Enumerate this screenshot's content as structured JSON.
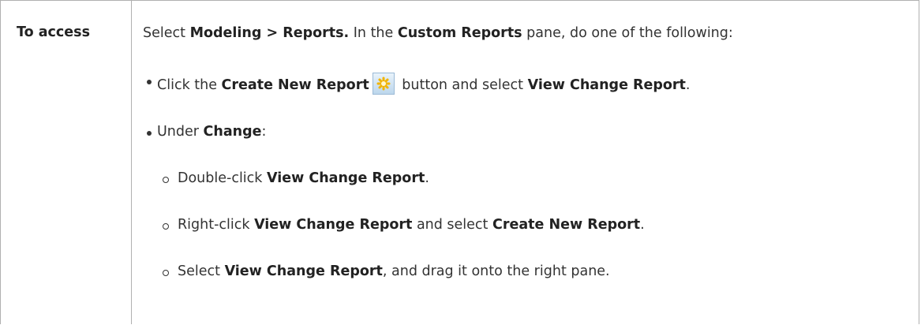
{
  "table": {
    "header_cell": "To access",
    "intro": {
      "t1": "Select ",
      "b1": "Modeling > Reports.",
      "t2": " In the ",
      "b2": "Custom Reports",
      "t3": " pane, do one of the following:"
    },
    "bullet1": {
      "t1": "Click the ",
      "b1": "Create New Report",
      "t2": " button and select ",
      "b2": "View Change Report",
      "t3": "."
    },
    "bullet2": {
      "t1": "Under ",
      "b1": "Change",
      "t2": ":"
    },
    "sub1": {
      "t1": "Double-click ",
      "b1": "View Change Report",
      "t2": "."
    },
    "sub2": {
      "t1": "Right-click ",
      "b1": "View Change Report",
      "t2": " and select ",
      "b2": "Create New Report",
      "t3": "."
    },
    "sub3": {
      "t1": "Select ",
      "b1": "View Change Report",
      "t2": ", and drag it onto the right pane."
    },
    "icon": "create-new-report-icon"
  }
}
